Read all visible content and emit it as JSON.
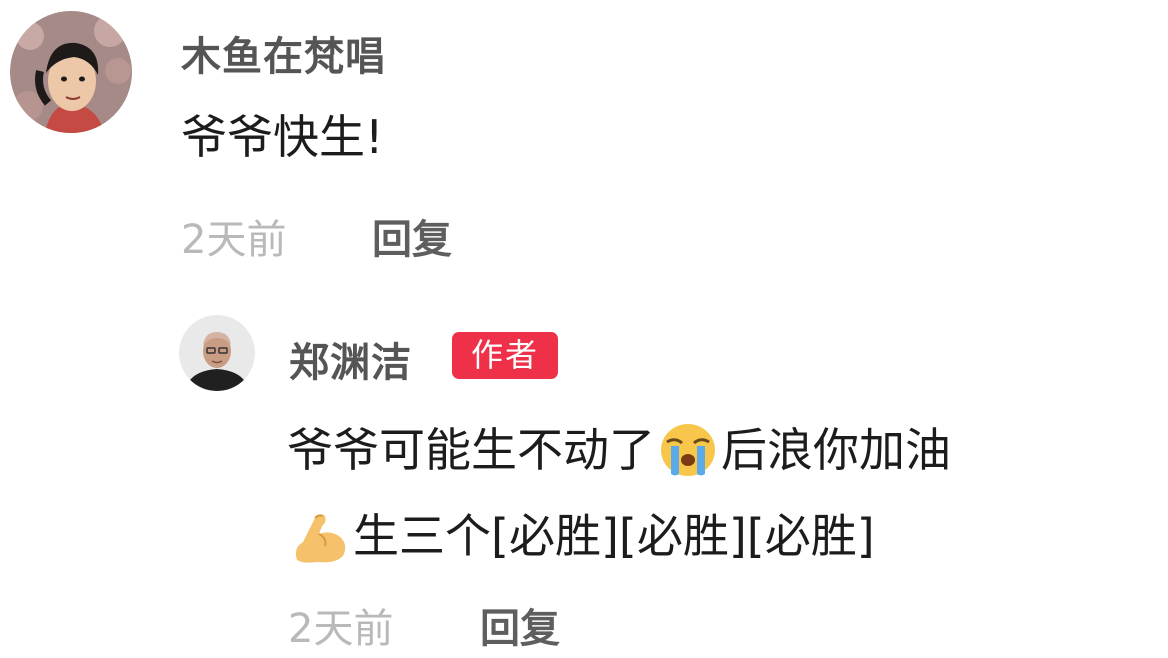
{
  "comment": {
    "username": "木鱼在梵唱",
    "text": "爷爷快生!",
    "time": "2天前",
    "reply_label": "回复",
    "avatar_icon": "cartoon-avatar-icon"
  },
  "reply_comment": {
    "username": "郑渊洁",
    "badge": "作者",
    "text_part1": "爷爷可能生不动了",
    "emoji1": "crying-face-icon",
    "text_part2": "后浪你加油",
    "emoji2": "flexed-biceps-icon",
    "text_part3": "生三个[必胜][必胜][必胜]",
    "time": "2天前",
    "reply_label": "回复",
    "avatar_icon": "man-photo-avatar-icon"
  },
  "colors": {
    "badge_bg": "#ee3049",
    "username": "#555555",
    "time": "#b9b9b9",
    "reply": "#5e5e5e",
    "text": "#1c1c1c"
  }
}
